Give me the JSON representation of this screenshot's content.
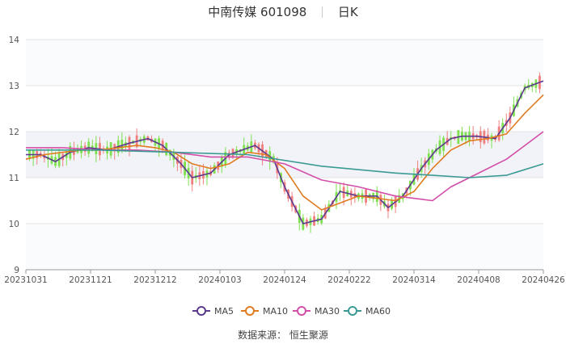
{
  "chart_data": {
    "type": "candlestick",
    "title": "中南传媒 601098",
    "period": "日K",
    "ylim": [
      9,
      14
    ],
    "yticks": [
      9,
      10,
      11,
      12,
      13,
      14
    ],
    "xtick_labels": [
      "20231031",
      "20231121",
      "20231212",
      "20240103",
      "20240124",
      "20240222",
      "20240314",
      "20240408",
      "20240426"
    ],
    "legend": [
      "MA5",
      "MA10",
      "MA30",
      "MA60"
    ],
    "colors": {
      "up": "#f08080",
      "down": "#7fe050",
      "MA5": "#5b3a8e",
      "MA10": "#e07b20",
      "MA30": "#d24ea8",
      "MA60": "#3a9a94",
      "band": "#f2f3f8"
    },
    "series": [
      {
        "name": "MA5",
        "x": [
          0,
          4,
          8,
          12,
          17,
          22,
          28,
          33,
          37,
          42,
          45,
          50,
          55,
          62,
          67,
          70,
          75,
          80,
          85,
          90,
          95,
          98,
          102,
          107,
          111,
          115,
          118,
          122,
          127,
          131,
          135,
          140
        ],
        "y": [
          11.5,
          11.5,
          11.35,
          11.55,
          11.65,
          11.6,
          11.75,
          11.85,
          11.7,
          11.3,
          11.0,
          11.1,
          11.5,
          11.7,
          11.4,
          10.8,
          10.0,
          10.1,
          10.7,
          10.6,
          10.6,
          10.35,
          10.6,
          11.2,
          11.6,
          11.85,
          11.9,
          11.9,
          11.85,
          12.3,
          12.95,
          13.1
        ]
      },
      {
        "name": "MA10",
        "x": [
          0,
          5,
          10,
          15,
          20,
          25,
          30,
          35,
          40,
          45,
          50,
          55,
          60,
          65,
          70,
          75,
          80,
          85,
          90,
          95,
          100,
          105,
          110,
          115,
          120,
          125,
          130,
          135,
          140
        ],
        "y": [
          11.4,
          11.5,
          11.55,
          11.6,
          11.6,
          11.65,
          11.7,
          11.65,
          11.55,
          11.3,
          11.2,
          11.3,
          11.55,
          11.5,
          11.2,
          10.6,
          10.3,
          10.45,
          10.6,
          10.55,
          10.5,
          10.7,
          11.2,
          11.6,
          11.8,
          11.85,
          11.95,
          12.4,
          12.8
        ]
      },
      {
        "name": "MA30",
        "x": [
          0,
          10,
          20,
          30,
          40,
          50,
          60,
          70,
          80,
          90,
          100,
          105,
          110,
          115,
          120,
          130,
          140
        ],
        "y": [
          11.65,
          11.65,
          11.6,
          11.6,
          11.55,
          11.45,
          11.45,
          11.3,
          10.95,
          10.8,
          10.6,
          10.55,
          10.5,
          10.8,
          11.0,
          11.4,
          12.0
        ]
      },
      {
        "name": "MA60",
        "x": [
          0,
          20,
          40,
          60,
          80,
          100,
          110,
          120,
          130,
          140
        ],
        "y": [
          11.6,
          11.6,
          11.55,
          11.5,
          11.25,
          11.1,
          11.05,
          11.0,
          11.05,
          11.3
        ]
      }
    ]
  },
  "source": "数据来源：  恒生聚源"
}
